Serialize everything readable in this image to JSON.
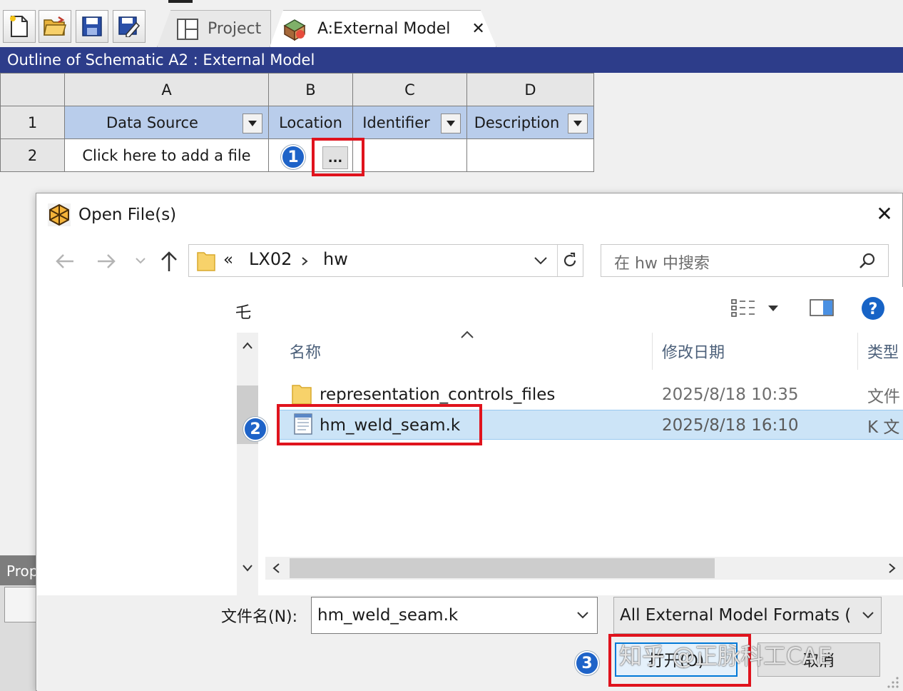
{
  "toolbar": {
    "buttons": [
      "new-file-icon",
      "open-folder-icon",
      "save-icon",
      "save-as-icon"
    ]
  },
  "tabs": {
    "project": "Project",
    "model": "A:External Model",
    "close_glyph": "✕"
  },
  "outline": {
    "title": "Outline of Schematic A2 : External Model",
    "columns": [
      "A",
      "B",
      "C",
      "D"
    ],
    "row_numbers": [
      "1",
      "2"
    ],
    "headers": [
      "Data Source",
      "Location",
      "Identifier",
      "Description"
    ],
    "add_file_text": "Click here to add a file",
    "browse_label": "...",
    "accent": "#2d3d8a"
  },
  "steps": [
    "1",
    "2",
    "3"
  ],
  "dialog": {
    "title": "Open File(s)",
    "close_glyph": "✕",
    "address": {
      "prefix": "«",
      "crumbs": [
        "LX02",
        "hw"
      ]
    },
    "search_placeholder": "在 hw 中搜索",
    "nav_partial_text": "乇",
    "columns": {
      "name": "名称",
      "date": "修改日期",
      "type": "类型"
    },
    "files": [
      {
        "name": "representation_controls_files",
        "date": "2025/8/18 10:35",
        "type": "文件",
        "icon": "folder-icon",
        "selected": false
      },
      {
        "name": "hm_weld_seam.k",
        "date": "2025/8/18 16:10",
        "type": "K 文",
        "icon": "text-file-icon",
        "selected": true
      }
    ],
    "filename_label": "文件名(N):",
    "filename_value": "hm_weld_seam.k",
    "filetype_value": "All External Model Formats (",
    "open_button": "打开(O)",
    "cancel_button": "取消",
    "left_panel_fragment": "Prop",
    "selection_color": "#cce4f7"
  },
  "watermark": "知乎 @正脉科工CAE",
  "highlight_color": "#e0131d"
}
